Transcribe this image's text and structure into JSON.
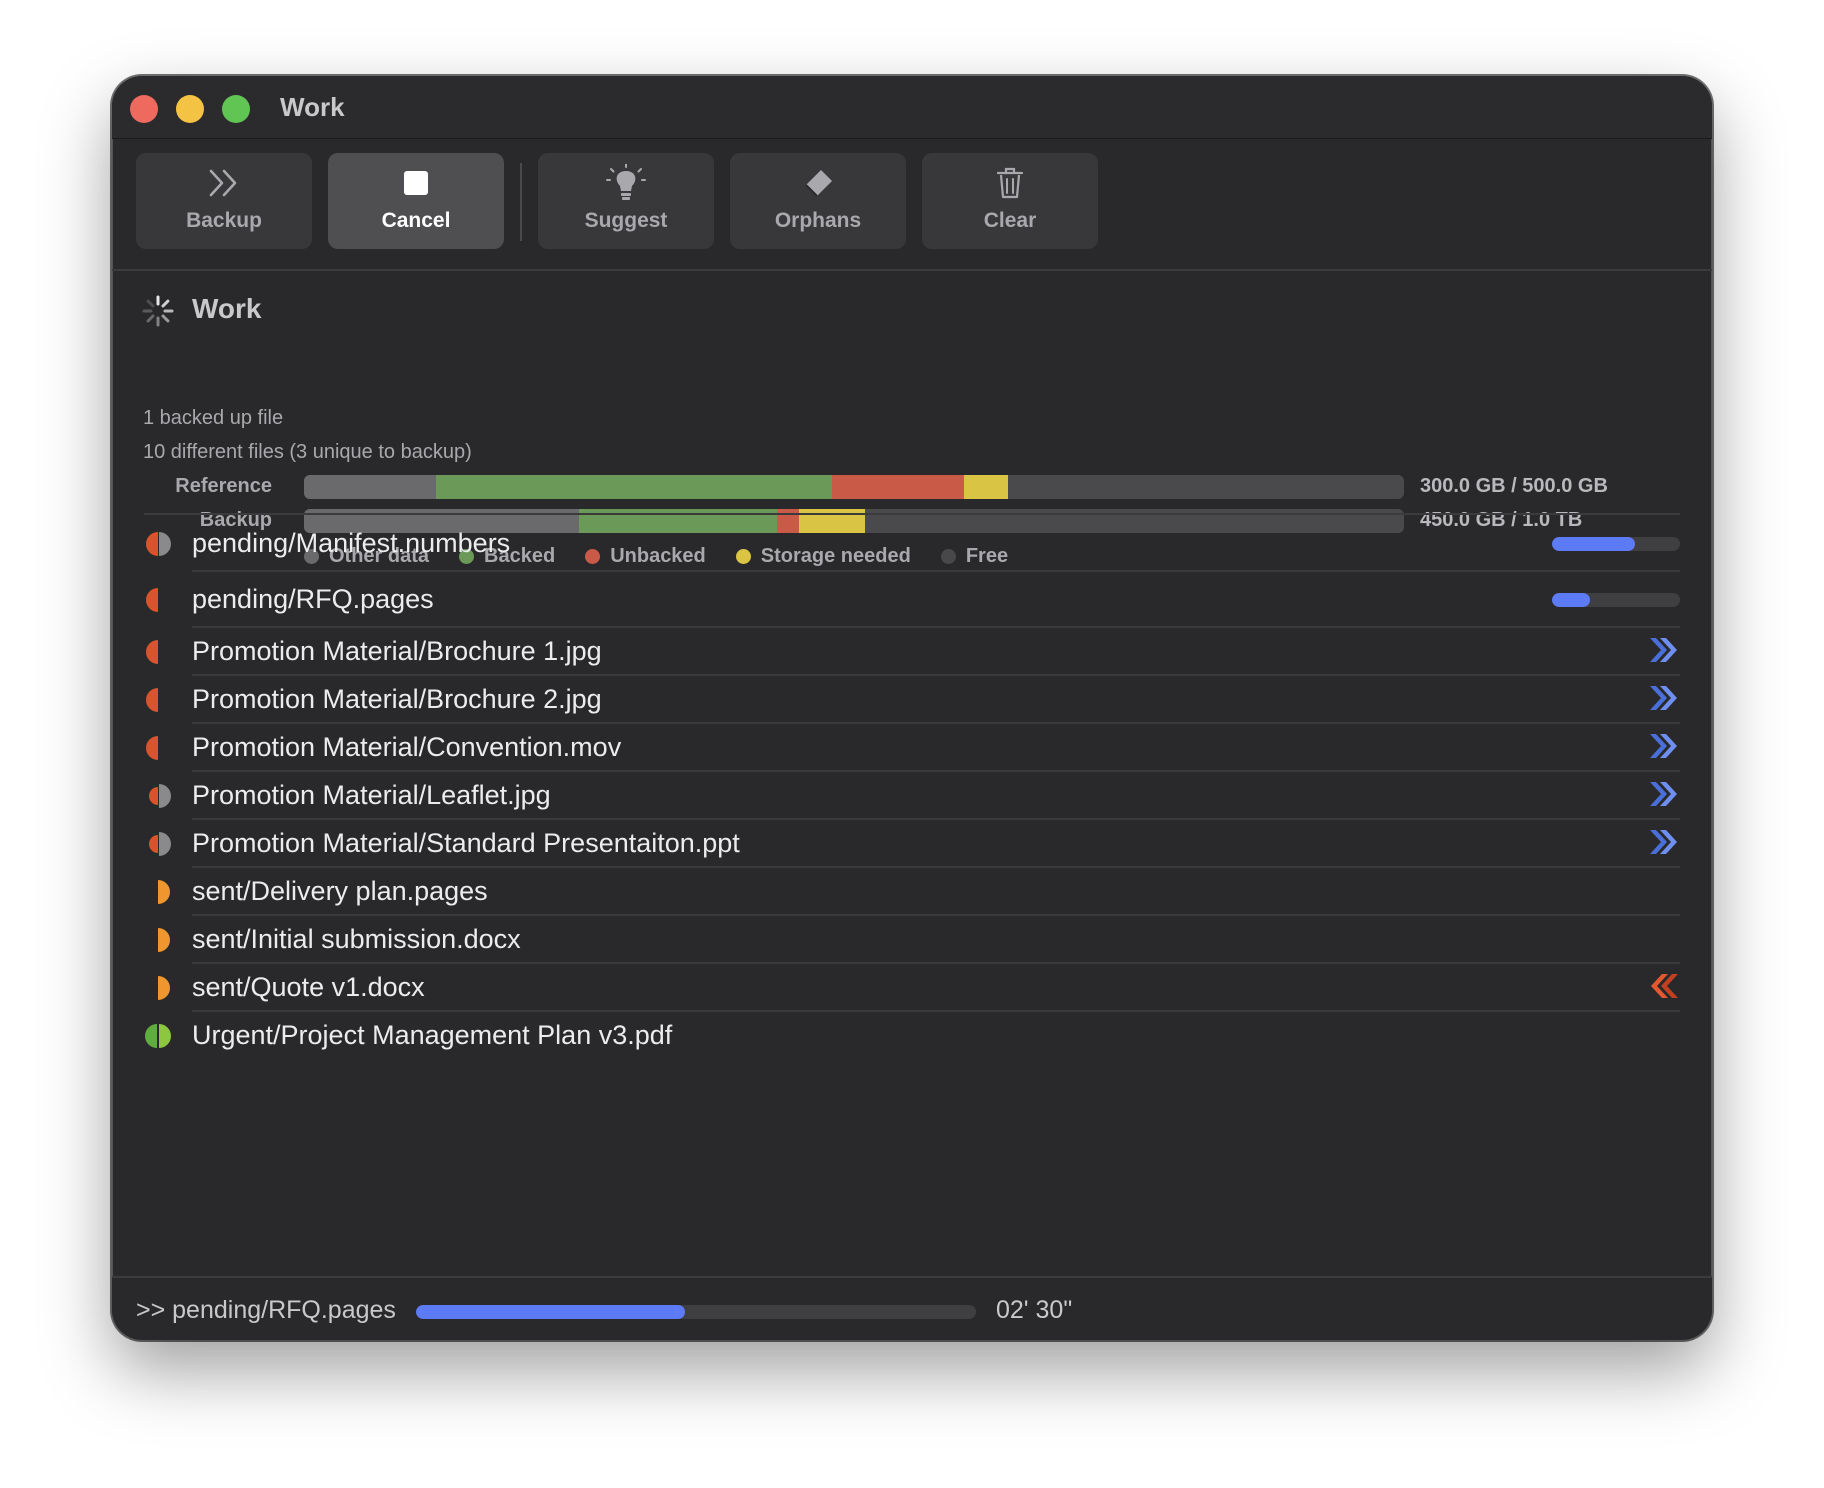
{
  "window": {
    "title": "Work"
  },
  "toolbar": {
    "buttons": [
      {
        "label": "Backup",
        "icon": "chevron-double-right-icon",
        "active": false
      },
      {
        "label": "Cancel",
        "icon": "stop-square-icon",
        "active": true
      },
      {
        "label": "Suggest",
        "icon": "lightbulb-icon",
        "active": false
      },
      {
        "label": "Orphans",
        "icon": "eraser-icon",
        "active": false
      },
      {
        "label": "Clear",
        "icon": "trash-icon",
        "active": false
      }
    ]
  },
  "summary": {
    "title": "Work",
    "backed_up_text": "1 backed up file",
    "different_text": "10 different files (3 unique to backup)",
    "bars": [
      {
        "label": "Reference",
        "value": "300.0 GB / 500.0 GB",
        "segments": [
          {
            "type": "Other data",
            "fraction": 0.12
          },
          {
            "type": "Backed",
            "fraction": 0.36
          },
          {
            "type": "Unbacked",
            "fraction": 0.12
          },
          {
            "type": "Storage needed",
            "fraction": 0.04
          }
        ]
      },
      {
        "label": "Backup",
        "value": "450.0 GB / 1.0 TB",
        "segments": [
          {
            "type": "Other data",
            "fraction": 0.25
          },
          {
            "type": "Backed",
            "fraction": 0.18
          },
          {
            "type": "Unbacked",
            "fraction": 0.02
          },
          {
            "type": "Storage needed",
            "fraction": 0.06
          }
        ]
      }
    ],
    "legend": [
      {
        "label": "Other data",
        "color": "#6a6a6d"
      },
      {
        "label": "Backed",
        "color": "#6b9a58"
      },
      {
        "label": "Unbacked",
        "color": "#c85a47"
      },
      {
        "label": "Storage needed",
        "color": "#d9c443"
      },
      {
        "label": "Free",
        "color": "#48484b"
      }
    ]
  },
  "files": [
    {
      "name": "pending/Manifest.numbers",
      "status": "red-grey-half",
      "progress": 0.65
    },
    {
      "name": "pending/RFQ.pages",
      "status": "red-left-half",
      "progress": 0.3
    },
    {
      "name": "Promotion Material/Brochure 1.jpg",
      "status": "red-left-half",
      "action": "push-to-backup-icon"
    },
    {
      "name": "Promotion Material/Brochure 2.jpg",
      "status": "red-left-half",
      "action": "push-to-backup-icon"
    },
    {
      "name": "Promotion Material/Convention.mov",
      "status": "red-left-half",
      "action": "push-to-backup-icon"
    },
    {
      "name": "Promotion Material/Leaflet.jpg",
      "status": "red-grey-small",
      "action": "push-to-backup-icon"
    },
    {
      "name": "Promotion Material/Standard Presentaiton.ppt",
      "status": "red-grey-small",
      "action": "push-to-backup-icon"
    },
    {
      "name": "sent/Delivery plan.pages",
      "status": "orange-right-half"
    },
    {
      "name": "sent/Initial submission.docx",
      "status": "orange-right-half"
    },
    {
      "name": "sent/Quote v1.docx",
      "status": "orange-right-half",
      "action": "restore-from-backup-icon"
    },
    {
      "name": "Urgent/Project Management Plan v3.pdf",
      "status": "green-full"
    }
  ],
  "footer": {
    "current": ">> pending/RFQ.pages",
    "progress": 0.48,
    "time": "02' 30\""
  },
  "colors": {
    "accent_blue": "#5e7bf6",
    "backed_green": "#6b9a58",
    "unbacked_red": "#c85a47",
    "storage_yellow": "#d9c443",
    "restore_orange": "#d9532c"
  }
}
